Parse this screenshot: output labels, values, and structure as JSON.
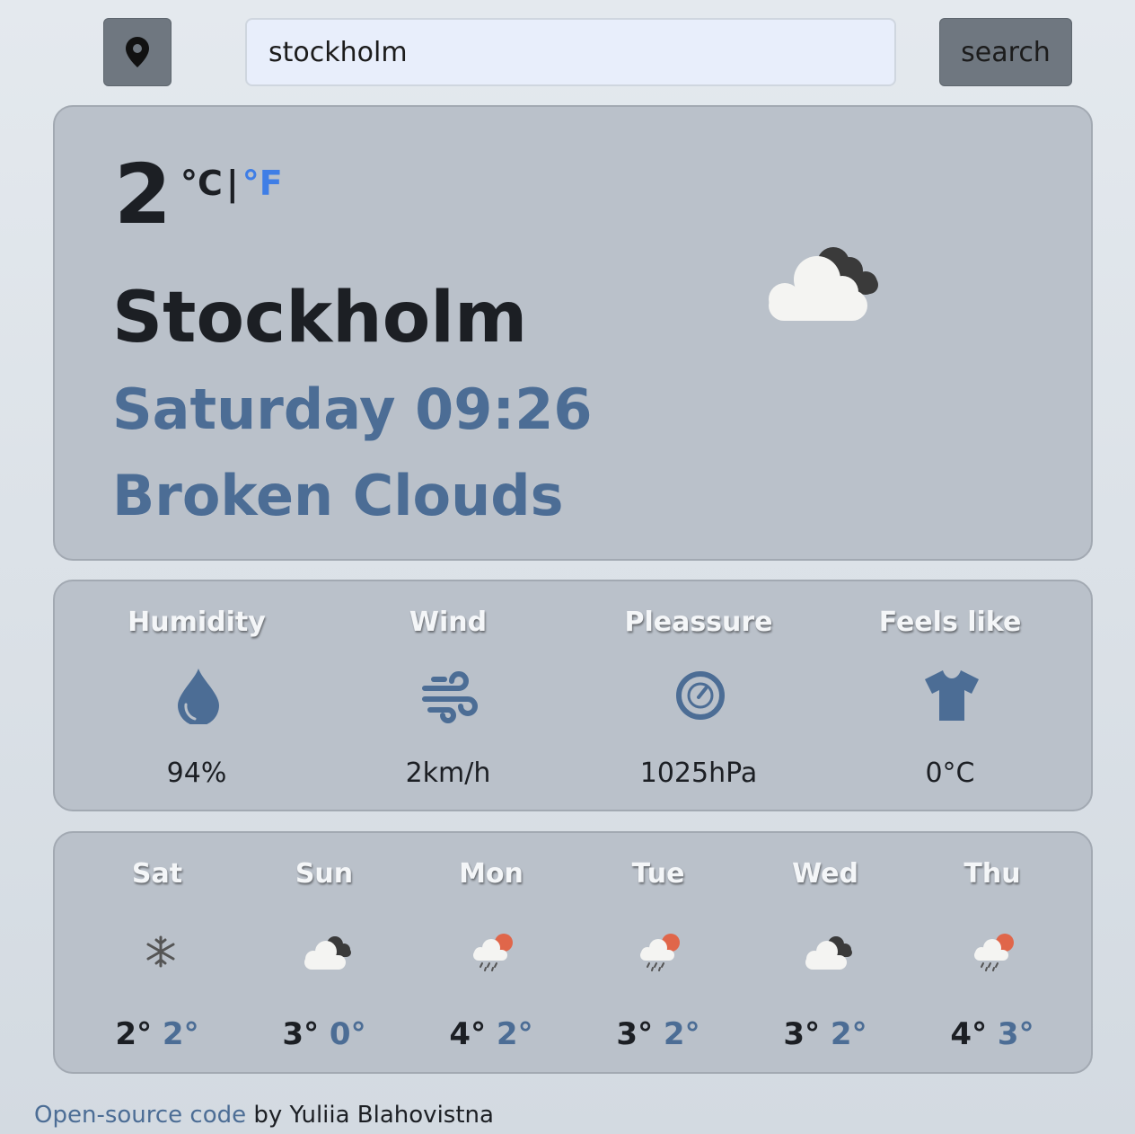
{
  "search": {
    "value": "stockholm",
    "button_label": "search",
    "location_icon": "map-pin-icon"
  },
  "current": {
    "temperature": "2",
    "unit_celsius": "°C",
    "unit_separator": "|",
    "unit_fahrenheit": "°F",
    "city": "Stockholm",
    "datetime": "Saturday 09:26",
    "description": "Broken Clouds",
    "icon": "broken-clouds-icon"
  },
  "details": [
    {
      "title": "Humidity",
      "value": "94%",
      "icon": "droplet-icon"
    },
    {
      "title": "Wind",
      "value": "2km/h",
      "icon": "wind-icon"
    },
    {
      "title": "Pleassure",
      "value": "1025hPa",
      "icon": "gauge-icon"
    },
    {
      "title": "Feels like",
      "value": "0°C",
      "icon": "tshirt-icon"
    }
  ],
  "forecast": [
    {
      "day": "Sat",
      "max": "2°",
      "min": "2°",
      "icon": "snow-icon"
    },
    {
      "day": "Sun",
      "max": "3°",
      "min": "0°",
      "icon": "broken-clouds-icon"
    },
    {
      "day": "Mon",
      "max": "4°",
      "min": "2°",
      "icon": "rain-sun-icon"
    },
    {
      "day": "Tue",
      "max": "3°",
      "min": "2°",
      "icon": "rain-sun-icon"
    },
    {
      "day": "Wed",
      "max": "3°",
      "min": "2°",
      "icon": "broken-clouds-icon"
    },
    {
      "day": "Thu",
      "max": "4°",
      "min": "3°",
      "icon": "rain-sun-icon"
    }
  ],
  "footer": {
    "link_text": "Open-source code",
    "suffix": " by Yuliia Blahovistna"
  },
  "colors": {
    "accent": "#4c6d95",
    "link_blue": "#3f7ee6",
    "card": "#bac1ca",
    "button": "#6f7780"
  }
}
